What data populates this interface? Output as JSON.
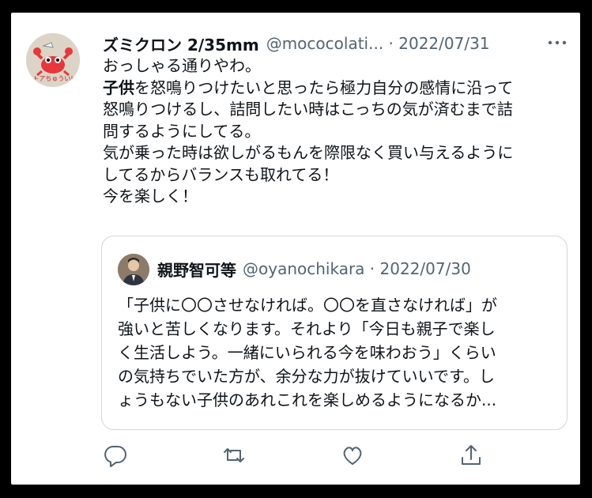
{
  "tweet": {
    "avatar_text": "トアちゅうい!",
    "display_name": "ズミクロン 2/35mm",
    "handle": "@mococolati...",
    "separator": " · ",
    "date": "2022/07/31",
    "more_icon": "more-dots-icon",
    "lines": [
      "おっしゃる通りやわ。",
      "子供を怒鳴りつけたいと思ったら極力自分の感情に沿って",
      "怒鳴りつけるし、詰問したい時はこっちの気が済むまで詰",
      "問するようにしてる。",
      "気が乗った時は欲しがるもんを際限なく買い与えるように",
      "してるからバランスも取れてる！",
      "今を楽しく！"
    ],
    "bold_word": "子供"
  },
  "quoted": {
    "display_name": "親野智可等",
    "handle": "@oyanochikara",
    "separator": " · ",
    "date": "2022/07/30",
    "lines": [
      "「子供に〇〇させなければ。〇〇を直さなければ」が",
      "強いと苦しくなります。それより「今日も親子で楽し",
      "く生活しよう。一緒にいられる今を味わおう」くらい",
      "の気持ちでいた方が、余分な力が抜けていいです。し",
      "ょうもない子供のあれこれを楽しめるようになるか..."
    ]
  },
  "actions": {
    "icons": [
      "reply-icon",
      "retweet-icon",
      "like-icon",
      "share-icon"
    ],
    "color": "#536471"
  },
  "colors": {
    "text": "#0f1419",
    "muted": "#536471",
    "border": "#cfd9de"
  }
}
